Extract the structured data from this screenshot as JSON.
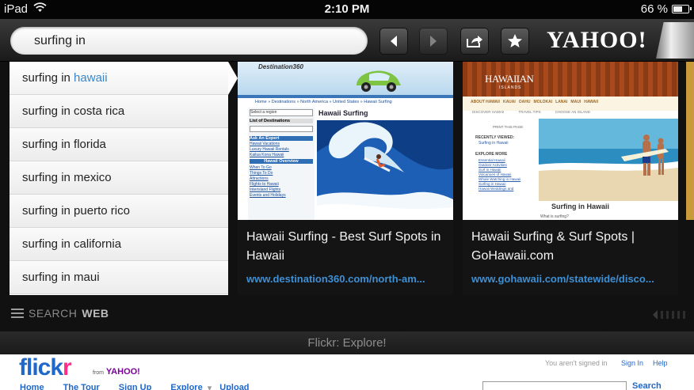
{
  "status": {
    "device": "iPad",
    "time": "2:10 PM",
    "battery": "66 %",
    "battery_level": 0.66
  },
  "search": {
    "query": "surfing in"
  },
  "header": {
    "logo": "YAHOO!"
  },
  "suggestions": [
    {
      "prefix": "surfing in ",
      "rest": "hawaii",
      "active": true
    },
    {
      "prefix": "surfing in ",
      "rest": "costa rica"
    },
    {
      "prefix": "surfing in ",
      "rest": "florida"
    },
    {
      "prefix": "surfing in ",
      "rest": "mexico"
    },
    {
      "prefix": "surfing in ",
      "rest": "puerto rico"
    },
    {
      "prefix": "surfing in ",
      "rest": "california"
    },
    {
      "prefix": "surfing in ",
      "rest": "maui"
    }
  ],
  "results": [
    {
      "title": "Hawaii Surfing - Best Surf Spots in Hawaii",
      "url": "www.destination360.com/north-am...",
      "thumb": {
        "site": "Destination360",
        "breadcrumb": "Home » Destinations » North America » United States » Hawaii Surfing",
        "heading": "Hawaii Surfing",
        "select": "Select a region",
        "list_header": "List of Destinations",
        "ask": "Ask An Expert",
        "links": [
          "Hawaii Vacations",
          "Luxury Hawaii Rentals",
          "Kailua Kona Hawaii"
        ],
        "overview": "Hawaii Overview",
        "overview_links": [
          "When To Go",
          "Things To Do",
          "Attractions",
          "Flights to Hawaii",
          "Interisland Flights",
          "Events and Holidays"
        ]
      }
    },
    {
      "title": "Hawaii Surfing & Surf Spots | GoHawaii.com",
      "url": "www.gohawaii.com/statewide/disco...",
      "thumb": {
        "site": "HAWAIIAN",
        "site_sub": "ISLANDS",
        "nav": [
          "ABOUT HAWAII",
          "KAUAI",
          "OAHU",
          "MOLOKAI",
          "LANAI",
          "MAUI",
          "HAWAII"
        ],
        "subnav": [
          "DISCOVER HAWAII",
          "TRAVEL TIPS",
          "CHOOSE AN ISLAND"
        ],
        "print": "PRINT THIS PAGE",
        "recent": "RECENTLY VIEWED:",
        "recent_item": "Surfing in Hawaii",
        "explore": "EXPLORE MORE",
        "explore_links": [
          "Essential Hawaii",
          "Outdoor Activities",
          "Surf in Hawaii",
          "Volcanoes of Hawaii",
          "Whale Watching in Hawaii",
          "Surfing in Hawaii",
          "Hawaii Weddings and"
        ],
        "heading": "Surfing in Hawaii",
        "sub": "What is surfing?"
      }
    }
  ],
  "search_web": {
    "prefix": "SEARCH ",
    "bold": "WEB"
  },
  "browser": {
    "title": "Flickr: Explore!"
  },
  "flickr": {
    "logo_a": "flick",
    "logo_b": "r",
    "from": "from",
    "yahoo": "YAHOO!",
    "not_signed": "You aren't signed in",
    "sign_in": "Sign In",
    "help": "Help",
    "nav": [
      "Home",
      "The Tour",
      "Sign Up",
      "Explore",
      "Upload"
    ],
    "search_btn": "Search"
  },
  "colors": {
    "link": "#3f8fd4",
    "highlight": "#3a86c8",
    "flickr_blue": "#1f68c9",
    "flickr_pink": "#ff2d8a"
  }
}
